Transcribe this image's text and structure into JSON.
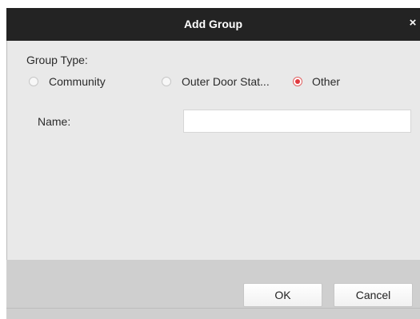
{
  "dialog": {
    "title": "Add Group",
    "close_glyph": "×"
  },
  "group_type": {
    "label": "Group Type:",
    "options": [
      {
        "label": "Community",
        "selected": false
      },
      {
        "label": "Outer Door Stat...",
        "selected": false
      },
      {
        "label": "Other",
        "selected": true
      }
    ]
  },
  "name_field": {
    "label": "Name:",
    "value": ""
  },
  "buttons": {
    "ok_label": "OK",
    "cancel_label": "Cancel"
  },
  "colors": {
    "titlebar": "#232323",
    "body": "#e9e9e9",
    "footer": "#cfcfcf",
    "radio_selected": "#e0393e"
  }
}
